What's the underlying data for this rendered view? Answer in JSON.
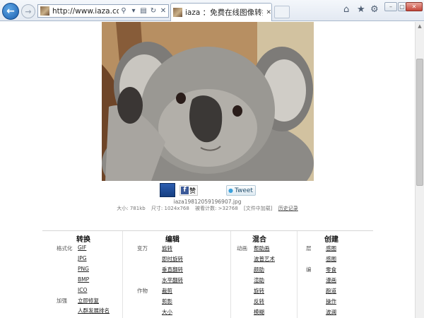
{
  "browser": {
    "url": "http://www.iaza.com/wo",
    "tab_title": "iaza ：免费在线图像转换-…",
    "tab_close": "✕",
    "back_icon": "arrow-left",
    "forward_icon": "arrow-right",
    "home_icon": "home",
    "favorites_icon": "star",
    "tools_icon": "gear"
  },
  "share": {
    "fb_label": "赞",
    "tweet_label": "Tweet"
  },
  "file": {
    "name": "iaza19812059196907.jpg",
    "size": "大小: 781kb",
    "dimensions": "尺寸: 1024x768",
    "counter": "被看计数: >32768",
    "ops": "[文件中加载]",
    "history": "历史记录"
  },
  "tools": {
    "convert": {
      "title": "转换",
      "labels": [
        "格式化",
        "加强"
      ],
      "links": [
        "GIF",
        "JPG",
        "PNG",
        "BMP",
        "ICO",
        "立即修复",
        "人群发展排名"
      ]
    },
    "edit": {
      "title": "编辑",
      "labels": [
        "变万",
        "作物"
      ],
      "links": [
        "旋转",
        "即时旋转",
        "垂直翻转",
        "水平翻转",
        "裁剪",
        "剪影",
        "大小"
      ]
    },
    "mix": {
      "title": "混合",
      "labels": [
        "动画"
      ],
      "links": [
        "帮助画",
        "波普艺术",
        "颜助",
        "渲助",
        "旋转",
        "反转",
        "模糊"
      ]
    },
    "create": {
      "title": "创建",
      "labels": [
        "层",
        "编"
      ],
      "links": [
        "感图",
        "感图",
        "零食",
        "漫画",
        "跑道",
        "操作",
        "波澜"
      ]
    }
  }
}
